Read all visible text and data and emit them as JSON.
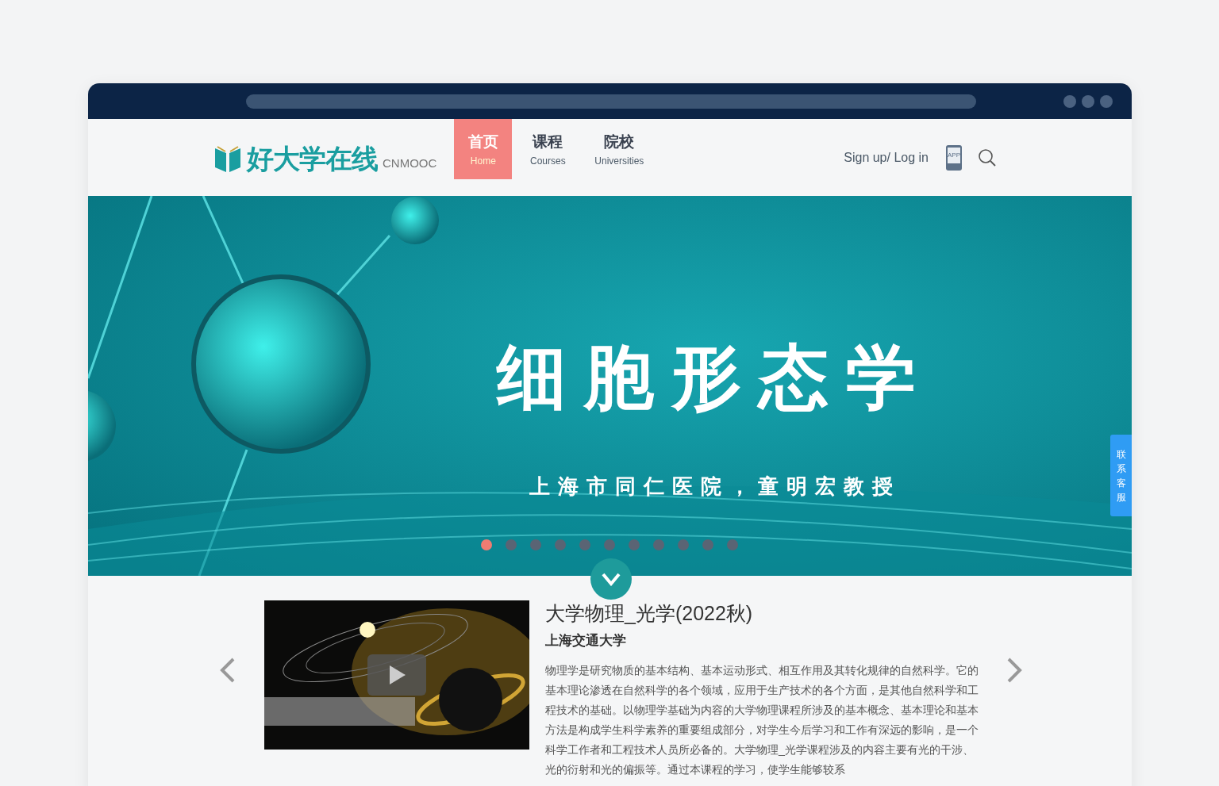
{
  "nav": {
    "logo": {
      "name": "好大学在线",
      "sub": "CNMOOC"
    },
    "items": [
      {
        "label": "首页",
        "sub": "Home",
        "selected": true
      },
      {
        "label": "课程",
        "sub": "Courses",
        "selected": false
      },
      {
        "label": "院校",
        "sub": "Universities",
        "selected": false
      }
    ],
    "login": "Sign up/ Log in",
    "app_label": "APP"
  },
  "banner": {
    "title": "细胞形态学",
    "subtitle": "上海市同仁医院，童明宏教授",
    "dots": [
      {
        "selected": true
      },
      {
        "selected": false
      },
      {
        "selected": false
      },
      {
        "selected": false
      },
      {
        "selected": false
      },
      {
        "selected": false
      },
      {
        "selected": false
      },
      {
        "selected": false
      },
      {
        "selected": false
      },
      {
        "selected": false
      },
      {
        "selected": false
      }
    ]
  },
  "side_tab": "联系客服",
  "course": {
    "title": "大学物理_光学(2022秋)",
    "school": "上海交通大学",
    "description": "物理学是研究物质的基本结构、基本运动形式、相互作用及其转化规律的自然科学。它的基本理论渗透在自然科学的各个领域，应用于生产技术的各个方面，是其他自然科学和工程技术的基础。以物理学基础为内容的大学物理课程所涉及的基本概念、基本理论和基本方法是构成学生科学素养的重要组成部分，对学生今后学习和工作有深远的影响，是一个科学工作者和工程技术人员所必备的。大学物理_光学课程涉及的内容主要有光的干涉、光的衍射和光的偏振等。通过本课程的学习，使学生能够较系"
  }
}
